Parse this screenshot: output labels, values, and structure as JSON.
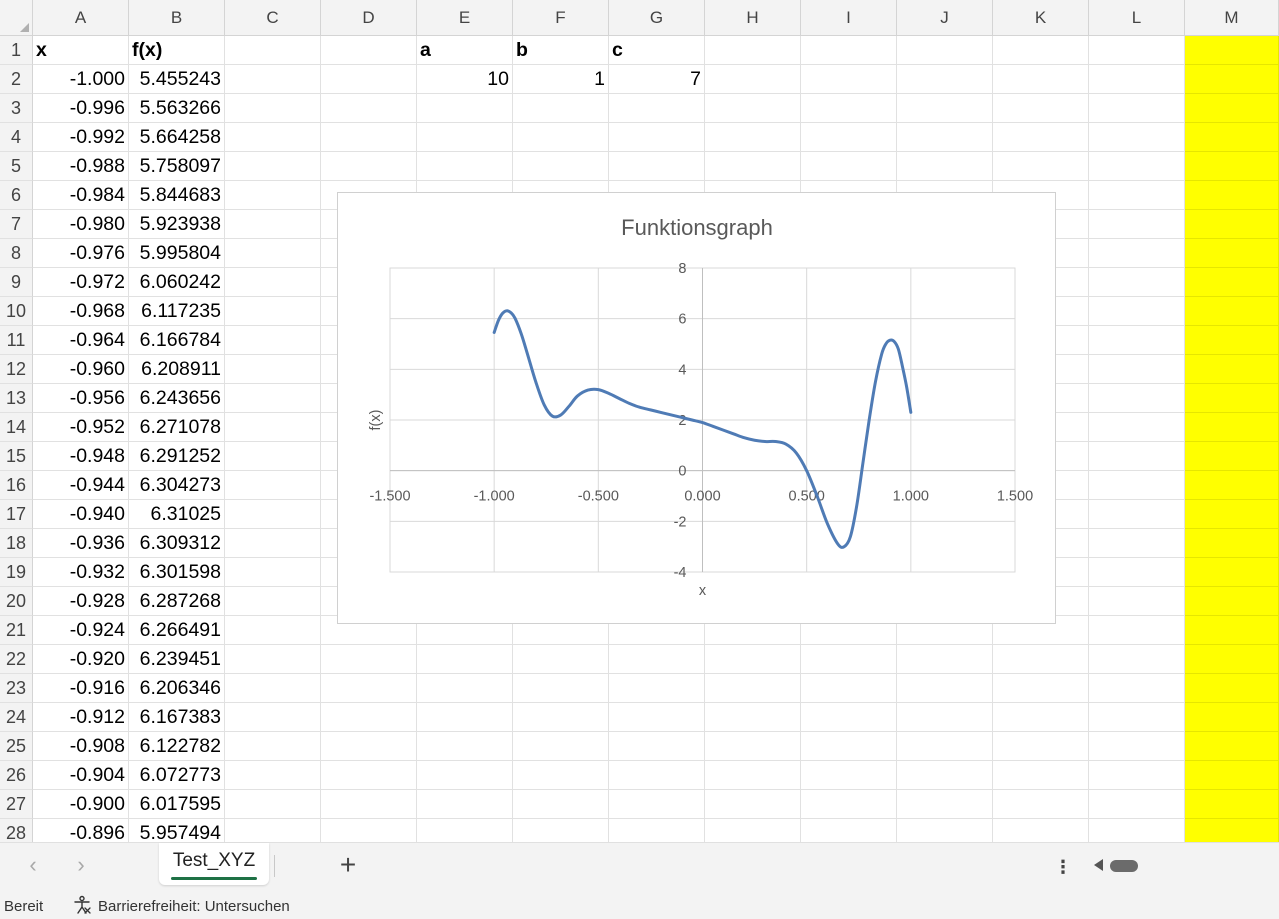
{
  "columns": [
    "A",
    "B",
    "C",
    "D",
    "E",
    "F",
    "G",
    "H",
    "I",
    "J",
    "K",
    "L",
    "M"
  ],
  "rows": [
    "1",
    "2",
    "3",
    "4",
    "5",
    "6",
    "7",
    "8",
    "9",
    "10",
    "11",
    "12",
    "13",
    "14",
    "15",
    "16",
    "17",
    "18",
    "19",
    "20",
    "21",
    "22",
    "23",
    "24",
    "25",
    "26",
    "27",
    "28"
  ],
  "header_row": {
    "x_label": "x",
    "fx_label": "f(x)",
    "a_label": "a",
    "b_label": "b",
    "c_label": "c"
  },
  "params": {
    "a": "10",
    "b": "1",
    "c": "7"
  },
  "table": [
    [
      "-1.000",
      "5.455243"
    ],
    [
      "-0.996",
      "5.563266"
    ],
    [
      "-0.992",
      "5.664258"
    ],
    [
      "-0.988",
      "5.758097"
    ],
    [
      "-0.984",
      "5.844683"
    ],
    [
      "-0.980",
      "5.923938"
    ],
    [
      "-0.976",
      "5.995804"
    ],
    [
      "-0.972",
      "6.060242"
    ],
    [
      "-0.968",
      "6.117235"
    ],
    [
      "-0.964",
      "6.166784"
    ],
    [
      "-0.960",
      "6.208911"
    ],
    [
      "-0.956",
      "6.243656"
    ],
    [
      "-0.952",
      "6.271078"
    ],
    [
      "-0.948",
      "6.291252"
    ],
    [
      "-0.944",
      "6.304273"
    ],
    [
      "-0.940",
      "6.31025"
    ],
    [
      "-0.936",
      "6.309312"
    ],
    [
      "-0.932",
      "6.301598"
    ],
    [
      "-0.928",
      "6.287268"
    ],
    [
      "-0.924",
      "6.266491"
    ],
    [
      "-0.920",
      "6.239451"
    ],
    [
      "-0.916",
      "6.206346"
    ],
    [
      "-0.912",
      "6.167383"
    ],
    [
      "-0.908",
      "6.122782"
    ],
    [
      "-0.904",
      "6.072773"
    ],
    [
      "-0.900",
      "6.017595"
    ],
    [
      "-0.896",
      "5.957494"
    ]
  ],
  "highlight_color": "#ffff00",
  "chart_data": {
    "type": "scatter",
    "title": "Funktionsgraph",
    "xlabel": "x",
    "ylabel": "f(x)",
    "xlim": [
      -1.5,
      1.5
    ],
    "ylim": [
      -4,
      8
    ],
    "xticks": [
      "-1.500",
      "-1.000",
      "-0.500",
      "0.000",
      "0.500",
      "1.000",
      "1.500"
    ],
    "yticks": [
      "-4",
      "-2",
      "0",
      "2",
      "4",
      "6",
      "8"
    ],
    "grid": true,
    "line_color": "#4f7bb5",
    "series": [
      {
        "x": [
          -1.0,
          -0.98,
          -0.96,
          -0.94,
          -0.92,
          -0.9,
          -0.87,
          -0.84,
          -0.8,
          -0.76,
          -0.72,
          -0.68,
          -0.64,
          -0.6,
          -0.55,
          -0.5,
          -0.45,
          -0.4,
          -0.35,
          -0.3,
          -0.25,
          -0.2,
          -0.15,
          -0.1,
          -0.05,
          0.0,
          0.05,
          0.1,
          0.15,
          0.2,
          0.25,
          0.3,
          0.35,
          0.4,
          0.45,
          0.5,
          0.55,
          0.6,
          0.65,
          0.68,
          0.71,
          0.74,
          0.77,
          0.8,
          0.83,
          0.86,
          0.88,
          0.9,
          0.92,
          0.94,
          0.96,
          0.98,
          1.0
        ],
        "y": [
          5.455,
          5.924,
          6.209,
          6.31,
          6.239,
          6.018,
          5.4,
          4.6,
          3.5,
          2.6,
          2.15,
          2.2,
          2.55,
          2.95,
          3.18,
          3.2,
          3.05,
          2.85,
          2.65,
          2.5,
          2.4,
          2.3,
          2.2,
          2.1,
          2.0,
          1.9,
          1.75,
          1.6,
          1.45,
          1.3,
          1.2,
          1.15,
          1.15,
          1.05,
          0.7,
          0.0,
          -1.0,
          -2.1,
          -2.9,
          -3.0,
          -2.6,
          -1.4,
          0.3,
          2.0,
          3.5,
          4.6,
          5.0,
          5.15,
          5.1,
          4.8,
          4.1,
          3.3,
          2.3
        ]
      }
    ]
  },
  "sheet_tab": "Test_XYZ",
  "add_sheet_icon": "plus-icon",
  "status": {
    "ready": "Bereit",
    "accessibility": "Barrierefreiheit: Untersuchen"
  }
}
